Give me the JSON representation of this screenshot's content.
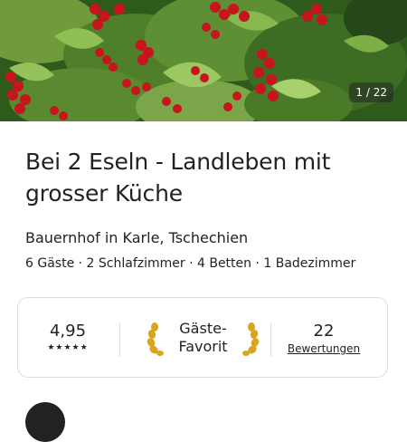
{
  "hero": {
    "photo_counter": "1 / 22",
    "image_description_icon": "red-currant-bush-photo"
  },
  "listing": {
    "title": "Bei 2 Eseln - Landleben mit grosser Küche",
    "subtitle": "Bauernhof in Karle, Tschechien",
    "details": "6 Gäste · 2 Schlafzimmer · 4 Betten · 1 Badezimmer"
  },
  "stats": {
    "rating": "4,95",
    "stars": "★★★★★",
    "badge_line1": "Gäste-",
    "badge_line2": "Favorit",
    "review_count": "22",
    "review_label": "Bewertungen"
  },
  "colors": {
    "text": "#222222",
    "border": "#dddddd",
    "laurel_gold": "#d9a520"
  }
}
